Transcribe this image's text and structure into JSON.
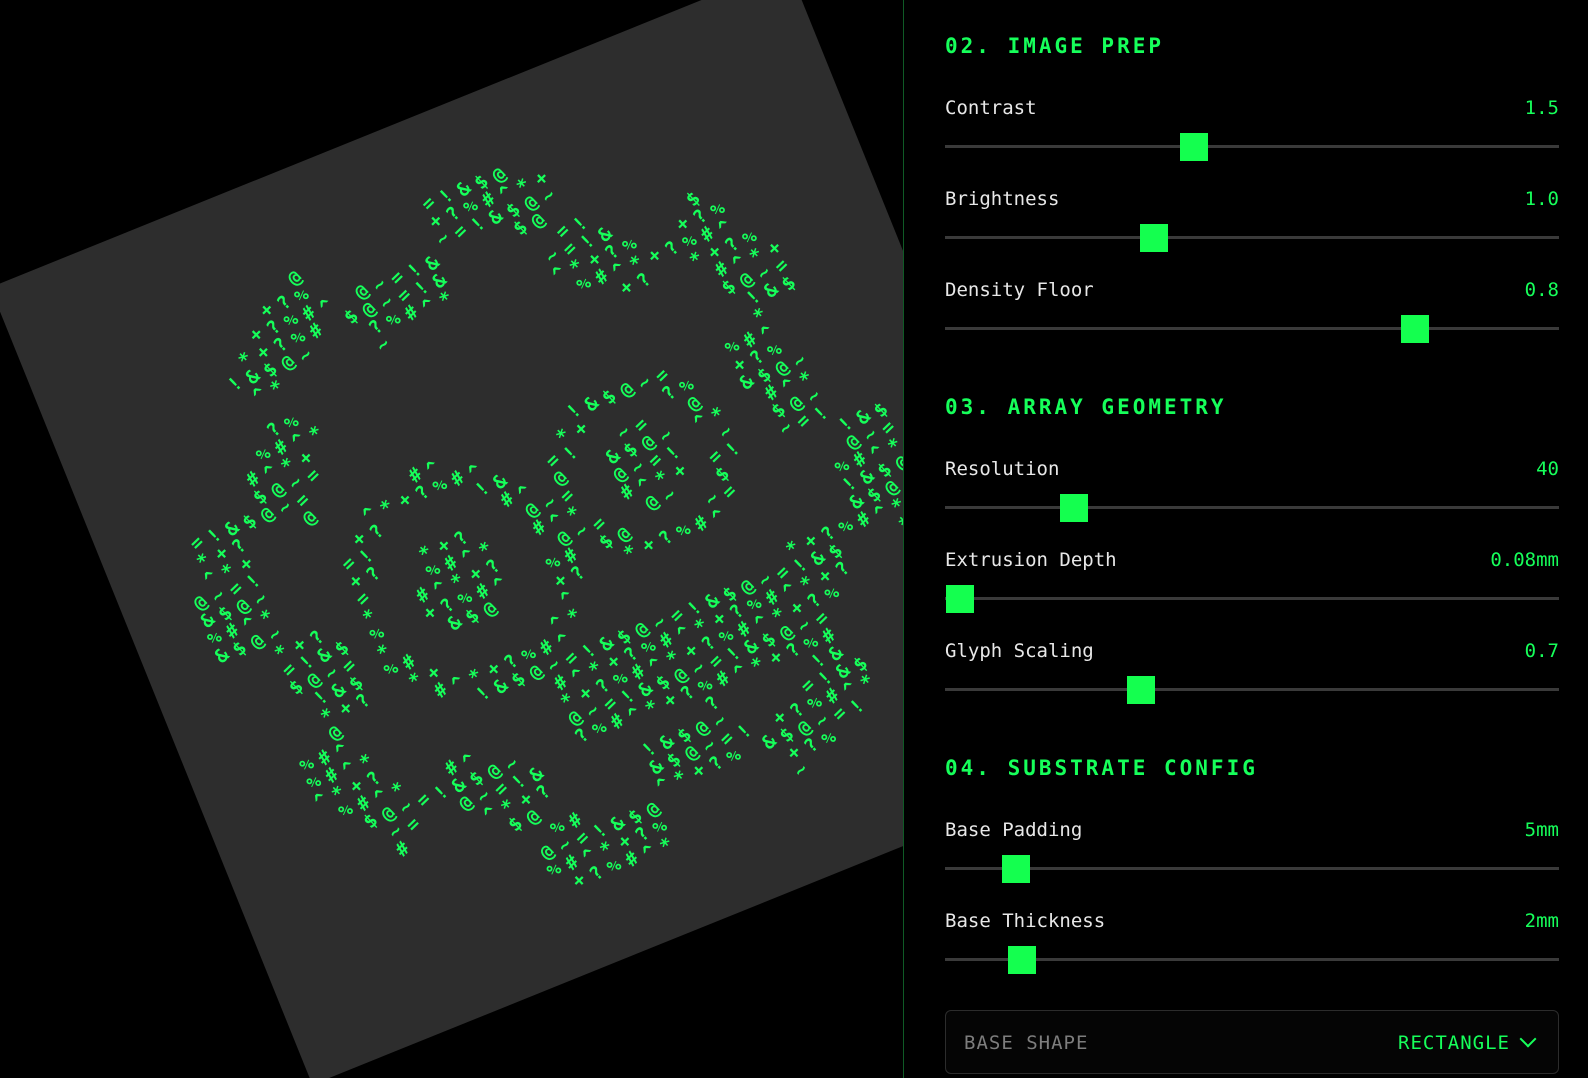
{
  "preview": {
    "glyph_set": [
      "@",
      "#",
      "$",
      "%",
      "&",
      "?",
      "!",
      "+",
      "=",
      "*",
      "~",
      "^"
    ],
    "glyph_color": "#16ff5a",
    "plate_color": "#2d2d2d"
  },
  "panel": {
    "sections": [
      {
        "title": "02. IMAGE PREP",
        "controls": [
          {
            "label": "Contrast",
            "value": "1.5",
            "level": 0.405
          },
          {
            "label": "Brightness",
            "value": "1.0",
            "level": 0.34
          },
          {
            "label": "Density Floor",
            "value": "0.8",
            "level": 0.765
          }
        ]
      },
      {
        "title": "03. ARRAY GEOMETRY",
        "controls": [
          {
            "label": "Resolution",
            "value": "40",
            "level": 0.21
          },
          {
            "label": "Extrusion Depth",
            "value": "0.08mm",
            "level": 0.025
          },
          {
            "label": "Glyph Scaling",
            "value": "0.7",
            "level": 0.32
          }
        ]
      },
      {
        "title": "04. SUBSTRATE CONFIG",
        "controls": [
          {
            "label": "Base Padding",
            "value": "5mm",
            "level": 0.115
          },
          {
            "label": "Base Thickness",
            "value": "2mm",
            "level": 0.125
          }
        ]
      }
    ],
    "base_shape": {
      "label": "BASE SHAPE",
      "value": "RECTANGLE"
    },
    "accent_color": "#16ff5a"
  }
}
